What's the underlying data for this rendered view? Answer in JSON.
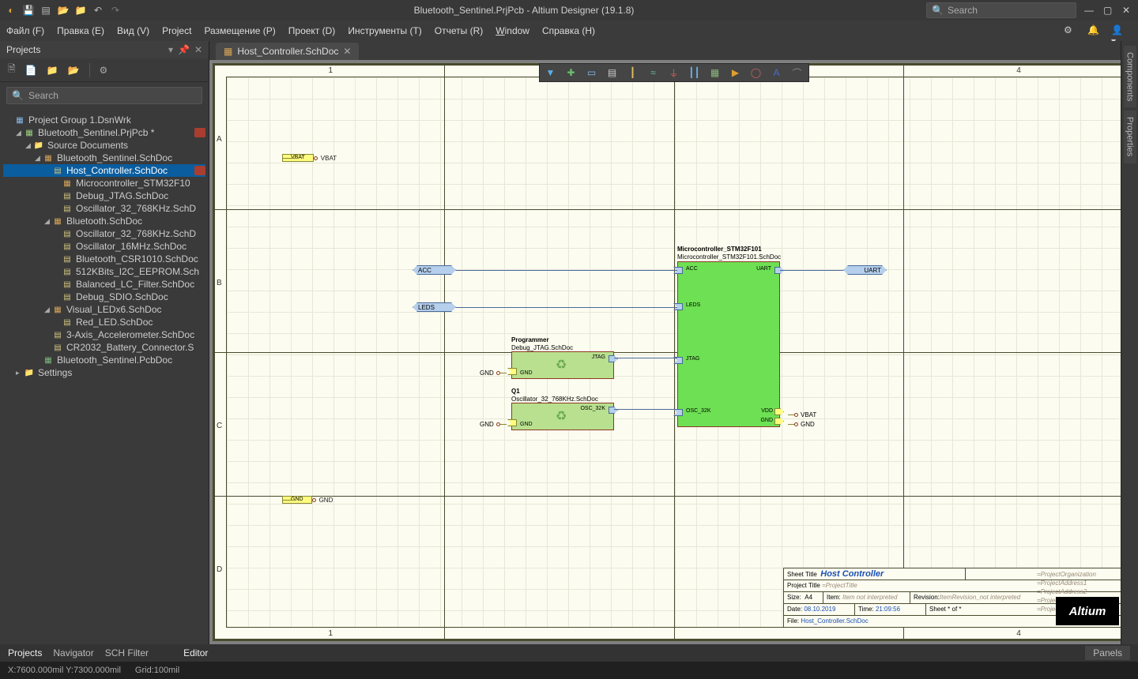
{
  "titlebar": {
    "title": "Bluetooth_Sentinel.PrjPcb - Altium Designer (19.1.8)",
    "search_placeholder": "Search"
  },
  "menubar": {
    "items": [
      "Файл (F)",
      "Правка (E)",
      "Вид (V)",
      "Project",
      "Размещение (P)",
      "Проект (D)",
      "Инструменты (T)",
      "Отчеты (R)",
      "Window",
      "Справка (H)"
    ]
  },
  "panel": {
    "title": "Projects",
    "search_placeholder": "Search",
    "root": "Project Group 1.DsnWrk",
    "project": "Bluetooth_Sentinel.PrjPcb *",
    "src": "Source Documents",
    "tree": [
      {
        "d": 3,
        "t": "sch",
        "l": "Bluetooth_Sentinel.SchDoc"
      },
      {
        "d": 4,
        "t": "schsub",
        "l": "Host_Controller.SchDoc",
        "sel": true,
        "badge": true
      },
      {
        "d": 5,
        "t": "sch",
        "l": "Microcontroller_STM32F10"
      },
      {
        "d": 5,
        "t": "schsub",
        "l": "Debug_JTAG.SchDoc"
      },
      {
        "d": 5,
        "t": "schsub",
        "l": "Oscillator_32_768KHz.SchD"
      },
      {
        "d": 4,
        "t": "sch",
        "l": "Bluetooth.SchDoc"
      },
      {
        "d": 5,
        "t": "schsub",
        "l": "Oscillator_32_768KHz.SchD"
      },
      {
        "d": 5,
        "t": "schsub",
        "l": "Oscillator_16MHz.SchDoc"
      },
      {
        "d": 5,
        "t": "schsub",
        "l": "Bluetooth_CSR1010.SchDoc"
      },
      {
        "d": 5,
        "t": "schsub",
        "l": "512KBits_I2C_EEPROM.Sch"
      },
      {
        "d": 5,
        "t": "schsub",
        "l": "Balanced_LC_Filter.SchDoc"
      },
      {
        "d": 5,
        "t": "schsub",
        "l": "Debug_SDIO.SchDoc"
      },
      {
        "d": 4,
        "t": "sch",
        "l": "Visual_LEDx6.SchDoc"
      },
      {
        "d": 5,
        "t": "schsub",
        "l": "Red_LED.SchDoc"
      },
      {
        "d": 4,
        "t": "schsub",
        "l": "3-Axis_Accelerometer.SchDoc"
      },
      {
        "d": 4,
        "t": "schsub",
        "l": "CR2032_Battery_Connector.S"
      },
      {
        "d": 3,
        "t": "pcb",
        "l": "Bluetooth_Sentinel.PcbDoc"
      }
    ],
    "settings": "Settings"
  },
  "tab": {
    "label": "Host_Controller.SchDoc"
  },
  "zones_top": [
    "1",
    "4"
  ],
  "zones_side": [
    "A",
    "B",
    "C",
    "D"
  ],
  "sheet": {
    "vbat": "VBAT",
    "gnd": "GND",
    "acc": "ACC",
    "leds": "LEDS",
    "uart": "UART",
    "jtag": "JTAG",
    "osc": "OSC_32K",
    "prog_title": "Programmer",
    "prog_sub": "Debug_JTAG.SchDoc",
    "q1_title": "Q1",
    "q1_sub": "Oscillator_32_768KHz.SchDoc",
    "mcu_title": "Microcontroller_STM32F101",
    "mcu_sub": "Microcontroller_STM32F101.SchDoc",
    "vdd": "VDD"
  },
  "titleblock": {
    "sheet_title_lbl": "Sheet Title",
    "sheet_title_val": "Host Controller",
    "proj_title_lbl": "Project Title",
    "proj_title_val": "=ProjectTitle",
    "size_lbl": "Size:",
    "size_val": "A4",
    "item_lbl": "Item:",
    "item_val": "Item not interpreted",
    "rev_lbl": "Revision:",
    "rev_val": "ItemRevision_not interpreted",
    "date_lbl": "Date:",
    "date_val": "08.10.2019",
    "time_lbl": "Time:",
    "time_val": "21:09:56",
    "sheet_lbl": "Sheet",
    "of": "of",
    "star": "*",
    "file_lbl": "File:",
    "file_val": "Host_Controller.SchDoc",
    "org": "=ProjectOrganization",
    "a1": "=ProjectAddress1",
    "a2": "=ProjectAddress2",
    "a3": "=ProjectAddress3",
    "a4": "=ProjectAddress4",
    "logo": "Altium"
  },
  "bottom": {
    "tabs": [
      "Projects",
      "Navigator",
      "SCH Filter"
    ],
    "editor": "Editor",
    "panels": "Panels"
  },
  "right_rail": [
    "Components",
    "Properties"
  ],
  "status": {
    "coord": "X:7600.000mil Y:7300.000mil",
    "grid": "Grid:100mil"
  }
}
